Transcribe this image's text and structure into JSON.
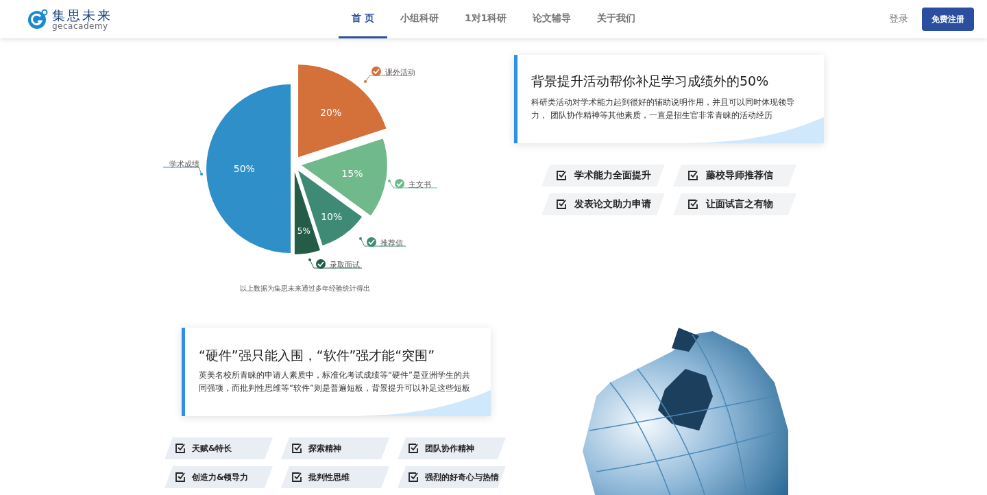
{
  "header": {
    "logo": {
      "name": "集思未来",
      "subtitle": "gecacademy"
    },
    "nav": [
      {
        "label": "首 页",
        "selected": true
      },
      {
        "label": "小组科研",
        "selected": false
      },
      {
        "label": "1对1科研",
        "selected": false
      },
      {
        "label": "论文辅导",
        "selected": false
      },
      {
        "label": "关于我们",
        "selected": false
      }
    ],
    "login": "登录",
    "register": "免费注册"
  },
  "pie": {
    "chart_data": {
      "type": "pie",
      "categories": [
        "学术成绩",
        "课外活动",
        "主文书",
        "推荐信",
        "录取面试"
      ],
      "values": [
        50,
        20,
        15,
        10,
        5
      ],
      "value_labels": [
        "50%",
        "20%",
        "15%",
        "10%",
        "5%"
      ],
      "legend": "right"
    },
    "note": "以上数据为集思未来通过多年经验统计得出"
  },
  "card1": {
    "title": "背景提升活动帮你补足学习成绩外的50%",
    "text": "科研类活动对学术能力起到很好的辅助说明作用，并且可以同时体现领导力， 团队协作精神等其他素质，一直是招生官非常青睐的活动经历"
  },
  "benefits": [
    "学术能力全面提升",
    "藤校导师推荐信",
    "发表论文助力申请",
    "让面试言之有物"
  ],
  "card2": {
    "title": "“硬件”强只能入围，“软件”强才能“突围”",
    "text": "英美名校所青睐的申请人素质中，标准化考试成绩等“硬件”是亚洲学生的共同强项，而批判性思维等“软件”则是普遍短板，背景提升可以补足这些短板"
  },
  "qualities": [
    "天赋&特长",
    "探索精神",
    "团队协作精神",
    "创造力&领导力",
    "批判性思维",
    "强烈的好奇心与热情"
  ]
}
